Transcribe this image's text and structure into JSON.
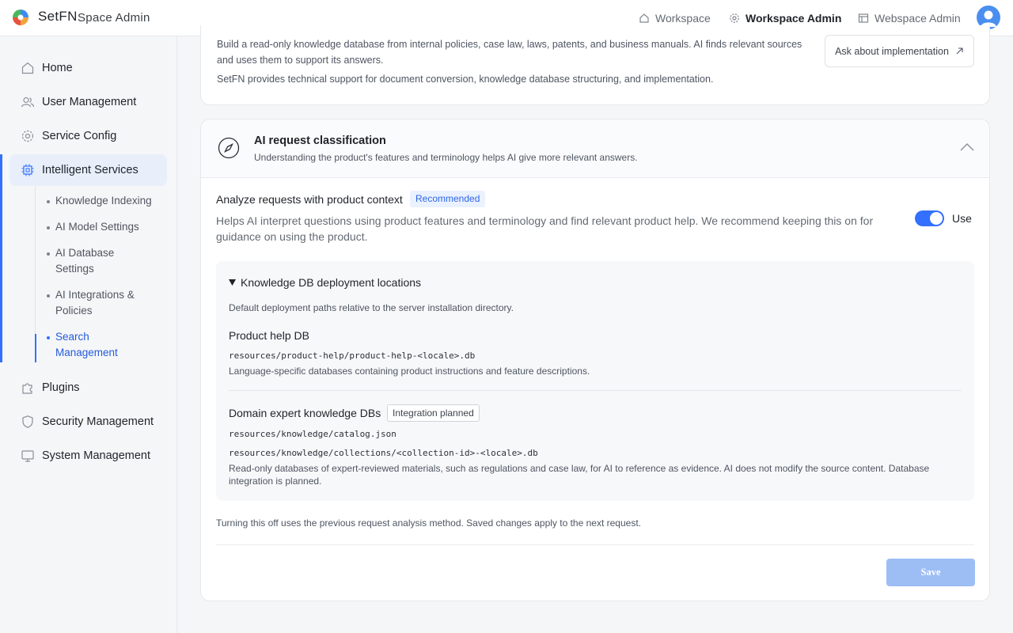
{
  "header": {
    "brand": "SetFN",
    "brand_sub": "Space Admin",
    "nav": [
      {
        "label": "Workspace",
        "icon": "home-icon"
      },
      {
        "label": "Workspace Admin",
        "icon": "gear-icon"
      },
      {
        "label": "Webspace Admin",
        "icon": "layout-icon"
      }
    ],
    "avatar_icon": "user-avatar-icon"
  },
  "sidebar": {
    "items": [
      {
        "label": "Home",
        "icon": "home-icon"
      },
      {
        "label": "User Management",
        "icon": "users-icon"
      },
      {
        "label": "Service Config",
        "icon": "gear-icon"
      },
      {
        "label": "Intelligent Services",
        "icon": "chip-icon"
      },
      {
        "label": "Plugins",
        "icon": "puzzle-icon"
      },
      {
        "label": "Security Management",
        "icon": "shield-icon"
      },
      {
        "label": "System Management",
        "icon": "monitor-icon"
      }
    ],
    "sub_items": [
      {
        "label": "Knowledge Indexing"
      },
      {
        "label": "AI Model Settings"
      },
      {
        "label": "AI Database Settings"
      },
      {
        "label": "AI Integrations & Policies"
      },
      {
        "label": "Search Management"
      }
    ]
  },
  "card1": {
    "text1": "Build a read-only knowledge database from internal policies, case law, laws, patents, and business manuals. AI finds relevant sources and uses them to support its answers.",
    "text2": "SetFN provides technical support for document conversion, knowledge database structuring, and implementation.",
    "ask_button": "Ask about implementation"
  },
  "card2": {
    "title": "AI request classification",
    "desc": "Understanding the product's features and terminology helps AI give more relevant answers.",
    "option_title": "Analyze requests with product context",
    "badge_recommended": "Recommended",
    "option_desc": "Helps AI interpret questions using product features and terminology and find relevant product help. We recommend keeping this on for guidance on using the product.",
    "toggle_label": "Use",
    "toggle_on": true,
    "panel": {
      "title": "Knowledge DB deployment locations",
      "desc": "Default deployment paths relative to the server installation directory.",
      "product_db": {
        "name": "Product help DB",
        "path": "resources/product-help/product-help-<locale>.db",
        "desc": "Language-specific databases containing product instructions and feature descriptions."
      },
      "domain_db": {
        "name": "Domain expert knowledge DBs",
        "badge": "Integration planned",
        "path1": "resources/knowledge/catalog.json",
        "path2": "resources/knowledge/collections/<collection-id>-<locale>.db",
        "desc": "Read-only databases of expert-reviewed materials, such as regulations and case law, for AI to reference as evidence. AI does not modify the source content. Database integration is planned."
      }
    },
    "footer_note": "Turning this off uses the previous request analysis method. Saved changes apply to the next request.",
    "save_label": "Save"
  },
  "colors": {
    "accent": "#3370ff",
    "save_disabled": "#9dbdf5"
  }
}
